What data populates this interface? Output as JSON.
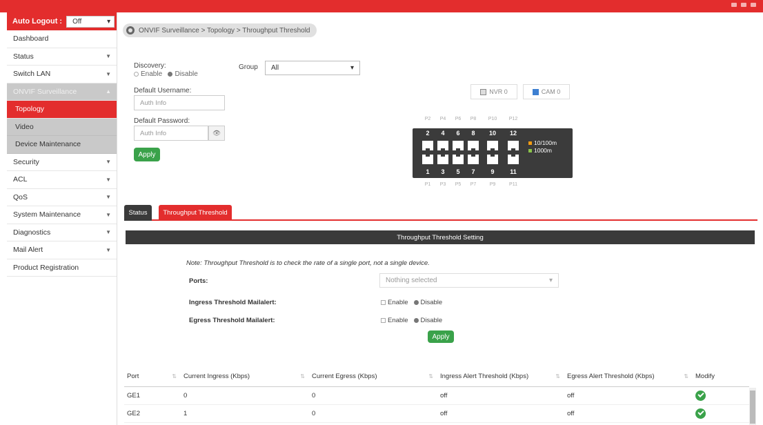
{
  "sidebar": {
    "auto_logout_label": "Auto Logout :",
    "auto_logout_value": "Off",
    "items": [
      {
        "label": "Dashboard"
      },
      {
        "label": "Status"
      },
      {
        "label": "Switch LAN"
      },
      {
        "label": "ONVIF Surveillance"
      },
      {
        "label": "Topology"
      },
      {
        "label": "Video"
      },
      {
        "label": "Device Maintenance"
      },
      {
        "label": "Security"
      },
      {
        "label": "ACL"
      },
      {
        "label": "QoS"
      },
      {
        "label": "System Maintenance"
      },
      {
        "label": "Diagnostics"
      },
      {
        "label": "Mail Alert"
      },
      {
        "label": "Product Registration"
      }
    ]
  },
  "breadcrumb": "ONVIF Surveillance > Topology > Throughput Threshold",
  "discovery": {
    "label": "Discovery:",
    "enable": "Enable",
    "disable": "Disable",
    "username_label": "Default Username:",
    "username_placeholder": "Auth Info",
    "password_label": "Default Password:",
    "password_placeholder": "Auth Info",
    "apply": "Apply"
  },
  "group": {
    "label": "Group",
    "value": "All"
  },
  "device_legend": {
    "nvr": "NVR 0",
    "cam": "CAM 0"
  },
  "switch": {
    "top_ports": [
      "2",
      "4",
      "6",
      "8",
      "10",
      "12"
    ],
    "bottom_ports": [
      "1",
      "3",
      "5",
      "7",
      "9",
      "11"
    ],
    "top_tags": [
      "P2",
      "P4",
      "P6",
      "P8",
      "P10",
      "P12"
    ],
    "bottom_tags": [
      "P1",
      "P3",
      "P5",
      "P7",
      "P9",
      "P11"
    ],
    "legend_10_100": "10/100m",
    "legend_1000": "1000m"
  },
  "tabs": {
    "status": "Status",
    "throughput": "Throughput Threshold"
  },
  "panel": {
    "header": "Throughput Threshold Setting",
    "note": "Note: Throughput Threshold is to check the rate of a single port, not a single device.",
    "ports_label": "Ports:",
    "ports_placeholder": "Nothing selected",
    "ingress_label": "Ingress Threshold Mailalert:",
    "egress_label": "Egress Threshold Mailalert:",
    "enable": "Enable",
    "disable": "Disable",
    "apply": "Apply"
  },
  "table": {
    "headers": [
      "Port",
      "Current Ingress (Kbps)",
      "Current Egress (Kbps)",
      "Ingress Alert Threshold (Kbps)",
      "Egress Alert Threshold (Kbps)",
      "Modify"
    ],
    "rows": [
      [
        "GE1",
        "0",
        "0",
        "off",
        "off"
      ],
      [
        "GE2",
        "1",
        "0",
        "off",
        "off"
      ]
    ]
  },
  "colors": {
    "accent": "#e32d2d",
    "apply": "#3aa24a",
    "dark": "#3a3a3a"
  }
}
